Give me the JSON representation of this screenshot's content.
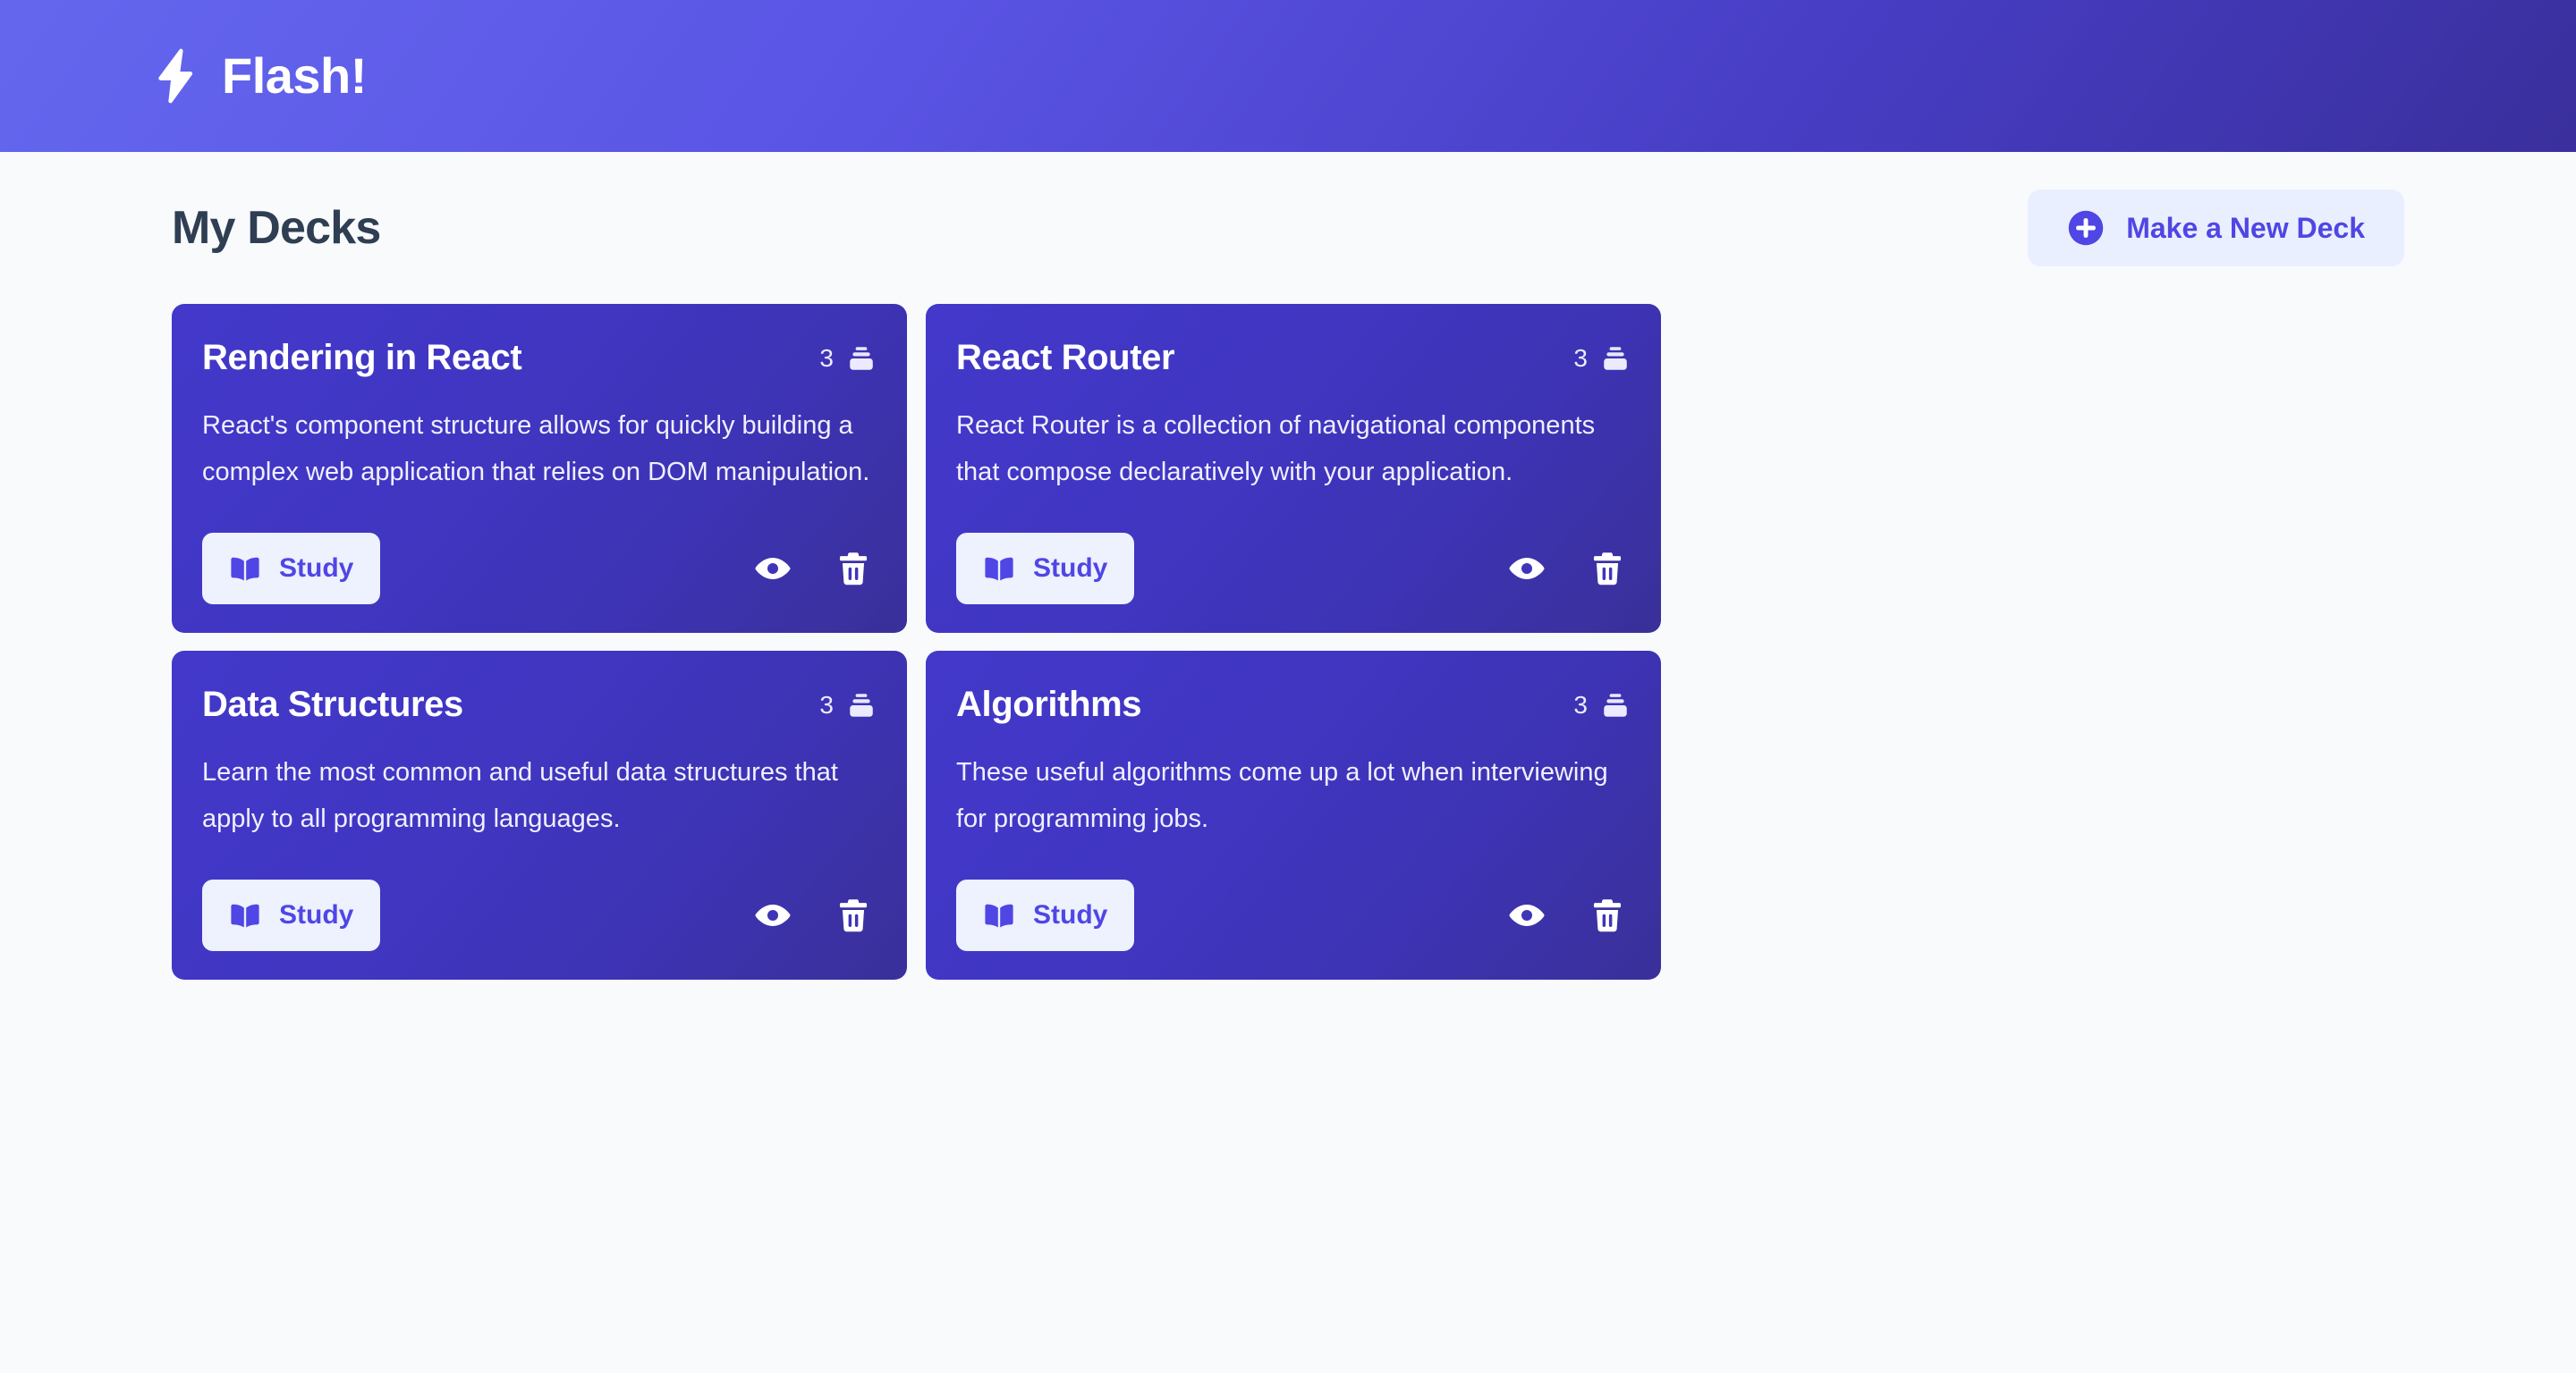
{
  "header": {
    "brand_title": "Flash!",
    "logo_icon": "lightning-bolt-icon"
  },
  "page": {
    "title": "My Decks",
    "new_deck_button": {
      "label": "Make a New Deck",
      "icon": "plus-circle-icon"
    }
  },
  "colors": {
    "header_gradient_start": "#6467ee",
    "header_gradient_end": "#3a2f9c",
    "card_gradient_start": "#4338ca",
    "card_gradient_end": "#3a3099",
    "accent": "#4f46e5",
    "button_surface": "#eef1fe",
    "page_background": "#f8fafc",
    "title_text": "#2f3e53"
  },
  "card_actions": {
    "study_label": "Study",
    "study_icon": "open-book-icon",
    "view_icon": "eye-icon",
    "delete_icon": "trash-icon",
    "count_icon": "card-stack-icon"
  },
  "decks": [
    {
      "name": "Rendering in React",
      "count": "3",
      "description": "React's component structure allows for quickly building a complex web application that relies on DOM manipulation."
    },
    {
      "name": "React Router",
      "count": "3",
      "description": "React Router is a collection of navigational components that compose declaratively with your application."
    },
    {
      "name": "Data Structures",
      "count": "3",
      "description": "Learn the most common and useful data structures that apply to all programming languages."
    },
    {
      "name": "Algorithms",
      "count": "3",
      "description": "These useful algorithms come up a lot when interviewing for programming jobs."
    }
  ]
}
